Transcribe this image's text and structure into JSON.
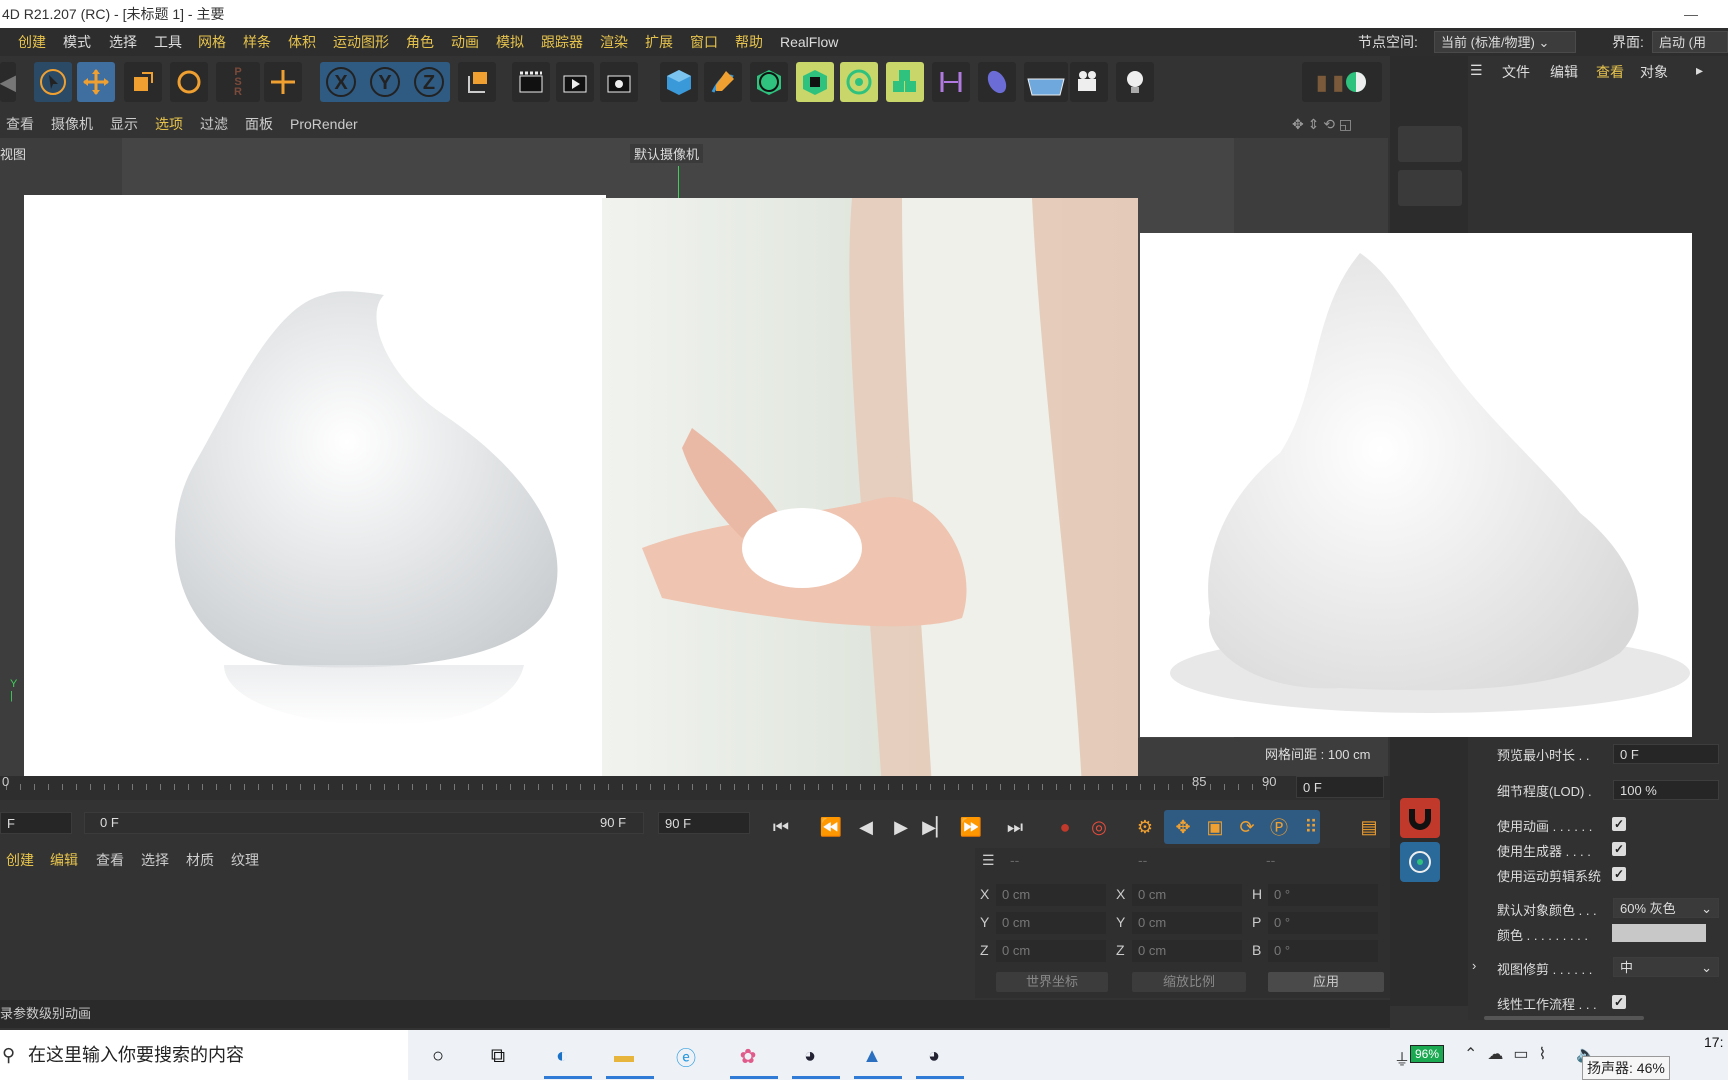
{
  "window": {
    "title": "4D R21.207 (RC) - [未标题 1] - 主要",
    "minimize_symbol": "—"
  },
  "menubar": {
    "items": [
      "创建",
      "模式",
      "选择",
      "工具",
      "网格",
      "样条",
      "体积",
      "运动图形",
      "角色",
      "动画",
      "模拟",
      "跟踪器",
      "渲染",
      "扩展",
      "窗口",
      "帮助",
      "RealFlow"
    ],
    "node_space_label": "节点空间:",
    "node_space_value": "当前 (标准/物理)",
    "layout_label": "界面:",
    "layout_value": "启动 (用户)"
  },
  "toolbar": {
    "axis_x": "X",
    "axis_y": "Y",
    "axis_z": "Z"
  },
  "viewport_menu": {
    "items": [
      "查看",
      "摄像机",
      "显示",
      "选项",
      "过滤",
      "面板",
      "ProRender"
    ]
  },
  "viewport": {
    "view_name": "视图",
    "camera_label": "默认摄像机",
    "grid_spacing": "网格间距 : 100 cm"
  },
  "right_panel": {
    "menu": [
      "文件",
      "编辑",
      "查看",
      "对象"
    ],
    "properties": [
      {
        "label": "预览最小时长 . .",
        "value": "0 F",
        "kind": "field"
      },
      {
        "label": "细节程度(LOD) .",
        "value": "100 %",
        "kind": "field"
      },
      {
        "label": "使用动画 . . . . . .",
        "value": "✓",
        "kind": "check"
      },
      {
        "label": "使用生成器 . . . .",
        "value": "✓",
        "kind": "check"
      },
      {
        "label": "使用运动剪辑系统",
        "value": "✓",
        "kind": "check"
      },
      {
        "label": "默认对象颜色 . . .",
        "value": "60% 灰色",
        "kind": "dropdown"
      },
      {
        "label": "颜色 . . . . . . . . .",
        "value": "",
        "kind": "color"
      },
      {
        "label": "视图修剪 . . . . . .",
        "value": "中",
        "kind": "dropdown"
      },
      {
        "label": "线性工作流程 . . .",
        "value": "✓",
        "kind": "check"
      }
    ],
    "color_swatch": "#c8c8c8"
  },
  "timeline": {
    "ruler_labels": [
      "0",
      "85",
      "90"
    ],
    "current_frame": "0 F",
    "start_frame": "F",
    "range_start": "0 F",
    "range_end": "90 F",
    "end_frame": "90 F"
  },
  "material_panel": {
    "menu": [
      "创建",
      "编辑",
      "查看",
      "选择",
      "材质",
      "纹理"
    ]
  },
  "coordinates": {
    "header": [
      "--",
      "--",
      "--"
    ],
    "rows": [
      {
        "a": "X",
        "av": "0 cm",
        "b": "X",
        "bv": "0 cm",
        "c": "H",
        "cv": "0 °"
      },
      {
        "a": "Y",
        "av": "0 cm",
        "b": "Y",
        "bv": "0 cm",
        "c": "P",
        "cv": "0 °"
      },
      {
        "a": "Z",
        "av": "0 cm",
        "b": "Z",
        "bv": "0 cm",
        "c": "B",
        "cv": "0 °"
      }
    ],
    "world_coords": "世界坐标",
    "scale": "缩放比例",
    "apply": "应用"
  },
  "status_bar": {
    "text": "录参数级别动画"
  },
  "taskbar": {
    "search_placeholder": "在这里输入你要搜索的内容",
    "battery": "96%",
    "tooltip": "扬声器: 46%",
    "clock": "17:"
  }
}
